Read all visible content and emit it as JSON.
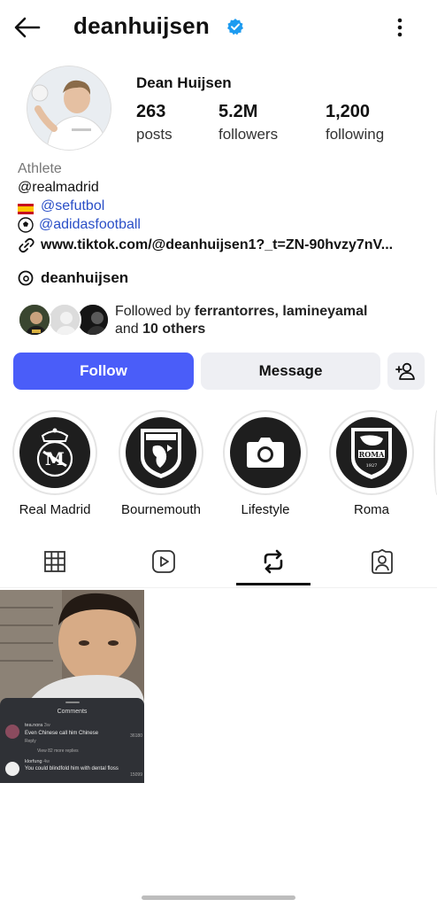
{
  "header": {
    "username": "deanhuijsen",
    "verified": true,
    "back_icon": "arrow-left-icon",
    "menu_icon": "more-vertical-icon"
  },
  "profile": {
    "display_name": "Dean Huijsen",
    "stats": [
      {
        "value": "263",
        "label": "posts"
      },
      {
        "value": "5.2M",
        "label": "followers"
      },
      {
        "value": "1,200",
        "label": "following"
      }
    ]
  },
  "bio": {
    "category": "Athlete",
    "threads_mention": "@realmadrid",
    "spain_mention": "@sefutbol",
    "football_mention": "@adidasfootball",
    "link": "www.tiktok.com/@deanhuijsen1?_t=ZN-90hvzy7nV..."
  },
  "threads": {
    "handle": "deanhuijsen"
  },
  "followed_by": {
    "prefix": "Followed by ",
    "names": "ferrantorres, lamineyamal",
    "and": "and ",
    "others": "10 others"
  },
  "actions": {
    "follow": "Follow",
    "message": "Message",
    "add_icon": "add-user-icon"
  },
  "highlights": [
    {
      "label": "Real Madrid"
    },
    {
      "label": "Bournemouth"
    },
    {
      "label": "Lifestyle"
    },
    {
      "label": "Roma"
    }
  ],
  "tabs": {
    "selected": "reposts",
    "items": [
      "grid-icon",
      "reels-icon",
      "reposts-icon",
      "tagged-icon"
    ]
  },
  "post": {
    "comments_title": "Comments",
    "c1_user": "tea.nora",
    "c1_time": "3w",
    "c1_text": "Even Chinese call him Chinese",
    "c1_reply": "Reply",
    "c1_likes": "36180",
    "c1_more": "View 82 more replies",
    "c2_user": "klorfung",
    "c2_time": "4w",
    "c2_text": "You could blindfold him with dental floss",
    "c2_likes": "15099"
  },
  "colors": {
    "follow_button": "#4a5df9",
    "secondary_button": "#eeeff3",
    "mention_link": "#2a4fc7",
    "verified_badge": "#1d9bf0"
  }
}
